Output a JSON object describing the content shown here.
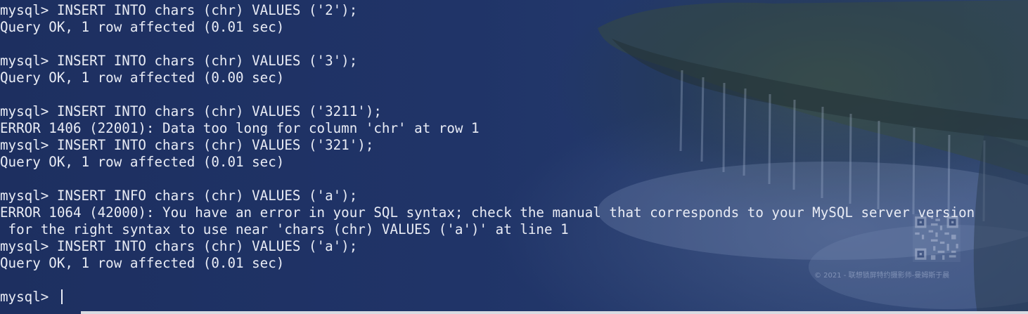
{
  "terminal": {
    "lines": [
      "mysql> INSERT INTO chars (chr) VALUES ('2');",
      "Query OK, 1 row affected (0.01 sec)",
      "",
      "mysql> INSERT INTO chars (chr) VALUES ('3');",
      "Query OK, 1 row affected (0.00 sec)",
      "",
      "mysql> INSERT INTO chars (chr) VALUES ('3211');",
      "ERROR 1406 (22001): Data too long for column 'chr' at row 1",
      "mysql> INSERT INTO chars (chr) VALUES ('321');",
      "Query OK, 1 row affected (0.01 sec)",
      "",
      "mysql> INSERT INFO chars (chr) VALUES ('a');",
      "ERROR 1064 (42000): You have an error in your SQL syntax; check the manual that corresponds to your MySQL server version",
      " for the right syntax to use near 'chars (chr) VALUES ('a')' at line 1",
      "mysql> INSERT INTO chars (chr) VALUES ('a');",
      "Query OK, 1 row affected (0.01 sec)",
      "",
      "mysql> "
    ],
    "text_color": "#e9ecf5",
    "background_color": "#1c2f5e"
  },
  "wallpaper": {
    "watermark_text": "© 2021 - 联想锁屏特约摄影师-曼姆斯于晨",
    "qr_icon": "qr-code-icon"
  }
}
